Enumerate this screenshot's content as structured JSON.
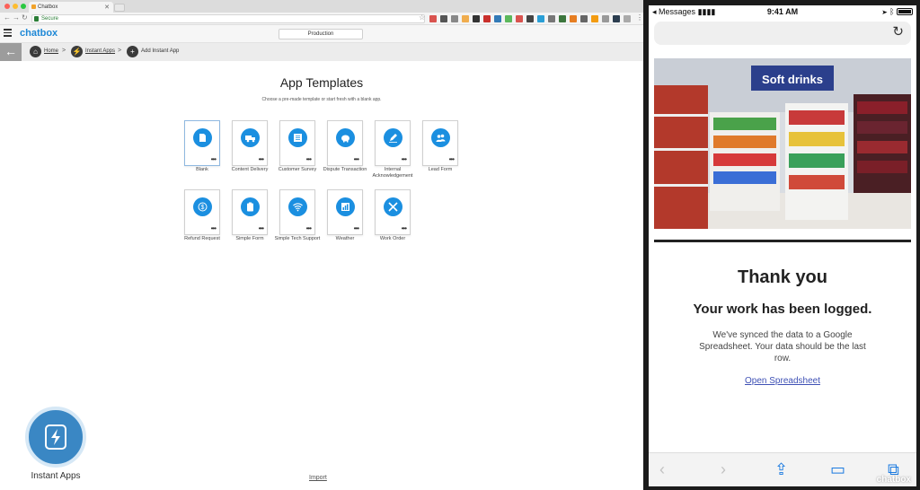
{
  "browser": {
    "tab_title": "Chatbox",
    "url_text": "Secure",
    "app_logo": "chatbox",
    "environment": "Production",
    "breadcrumb": {
      "home": "Home",
      "instant_apps": "Instant Apps",
      "add_instant_app": "Add Instant App"
    },
    "page": {
      "title": "App Templates",
      "subtitle": "Choose a pre-made template or start fresh with a blank app.",
      "templates": [
        {
          "label": "Blank",
          "icon": "blank-doc-icon"
        },
        {
          "label": "Content Delivery",
          "icon": "truck-icon"
        },
        {
          "label": "Customer Survey",
          "icon": "survey-list-icon"
        },
        {
          "label": "Dispute Transaction",
          "icon": "piggy-bank-icon"
        },
        {
          "label": "Internal Acknowledgement",
          "icon": "pencil-icon"
        },
        {
          "label": "Lead Form",
          "icon": "people-icon"
        },
        {
          "label": "Refund Request",
          "icon": "dollar-refund-icon"
        },
        {
          "label": "Simple Form",
          "icon": "clipboard-icon"
        },
        {
          "label": "Simple Tech Support",
          "icon": "wifi-icon"
        },
        {
          "label": "Weather",
          "icon": "bar-chart-icon"
        },
        {
          "label": "Work Order",
          "icon": "tools-icon"
        }
      ]
    },
    "fab_label": "Instant Apps",
    "import_link": "Import"
  },
  "phone": {
    "status": {
      "carrier": "Messages",
      "time": "9:41 AM"
    },
    "photo_sign": "Soft drinks",
    "thank_you": "Thank you",
    "logged": "Your work has been logged.",
    "body": "We've synced the data to a Google Spreadsheet. Your data should be the last row.",
    "link": "Open Spreadsheet",
    "watermark": "chatbox"
  },
  "colors": {
    "accent": "#1b8fe0",
    "fab": "#3a87c4",
    "link": "#3f51b5"
  }
}
